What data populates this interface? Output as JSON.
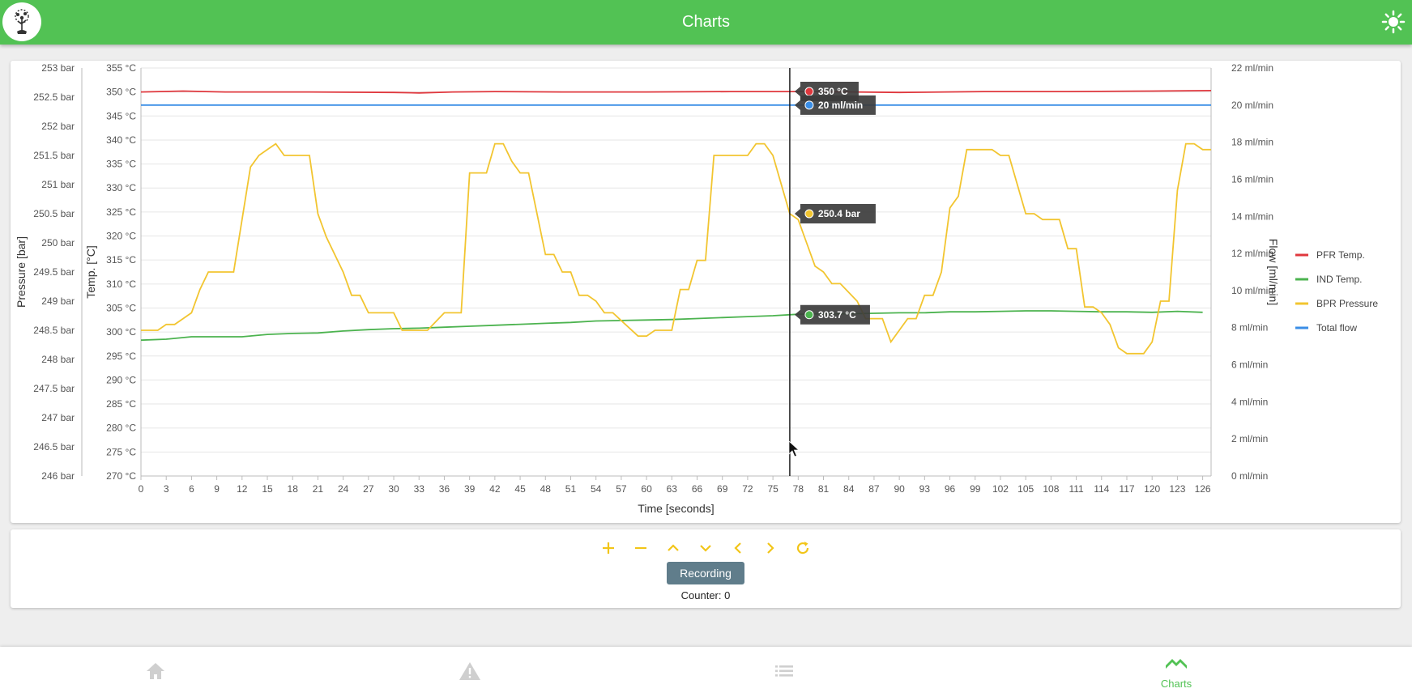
{
  "header": {
    "title": "Charts",
    "logo_icon": "tree-logo-icon",
    "theme_icon": "sun-icon"
  },
  "colors": {
    "primary": "#52c254",
    "accent": "#f5c518",
    "pfr": "#e0383e",
    "ind": "#4cb34f",
    "bpr": "#f2c530",
    "flow": "#3a8ee6"
  },
  "chart_data": {
    "type": "line",
    "xlabel": "Time [seconds]",
    "xlim": [
      0,
      127
    ],
    "xticks": [
      0,
      3,
      6,
      9,
      12,
      15,
      18,
      21,
      24,
      27,
      30,
      33,
      36,
      39,
      42,
      45,
      48,
      51,
      54,
      57,
      60,
      63,
      66,
      69,
      72,
      75,
      78,
      81,
      84,
      87,
      90,
      93,
      96,
      99,
      102,
      105,
      108,
      111,
      114,
      117,
      120,
      123,
      126
    ],
    "axes": {
      "pressure": {
        "label": "Pressure [bar]",
        "min": 246,
        "max": 253,
        "step": 0.5,
        "unit": "bar"
      },
      "temp": {
        "label": "Temp. [°C]",
        "min": 270,
        "max": 355,
        "step": 5,
        "unit": "°C"
      },
      "flow": {
        "label": "Flow [ml/min]",
        "min": 0,
        "max": 22,
        "step": 2,
        "unit": "ml/min"
      }
    },
    "series": [
      {
        "name": "PFR Temp.",
        "axis": "temp",
        "color": "#e0383e",
        "x": [
          0,
          5,
          10,
          20,
          30,
          33,
          37,
          42,
          50,
          60,
          70,
          80,
          90,
          100,
          110,
          120,
          127
        ],
        "y": [
          350,
          350.2,
          350,
          350,
          349.9,
          349.8,
          350,
          350.1,
          350,
          350,
          350.1,
          350.1,
          349.9,
          350.1,
          350.1,
          350.2,
          350.3
        ]
      },
      {
        "name": "IND Temp.",
        "axis": "temp",
        "color": "#4cb34f",
        "x": [
          0,
          3,
          6,
          9,
          12,
          15,
          18,
          21,
          24,
          27,
          30,
          33,
          36,
          39,
          42,
          45,
          48,
          51,
          54,
          57,
          60,
          63,
          66,
          69,
          72,
          75,
          78,
          81,
          84,
          87,
          90,
          93,
          96,
          99,
          102,
          105,
          108,
          111,
          114,
          117,
          120,
          123,
          126
        ],
        "y": [
          298.3,
          298.5,
          299,
          299,
          299,
          299.5,
          299.7,
          299.8,
          300.2,
          300.5,
          300.7,
          300.8,
          301,
          301.2,
          301.4,
          301.6,
          301.8,
          302,
          302.3,
          302.4,
          302.5,
          302.6,
          302.8,
          303,
          303.2,
          303.4,
          303.7,
          303.8,
          303.8,
          303.9,
          304,
          304,
          304.2,
          304.2,
          304.3,
          304.4,
          304.4,
          304.3,
          304.2,
          304.2,
          304.1,
          304.3,
          304.1
        ]
      },
      {
        "name": "BPR Pressure",
        "axis": "pressure",
        "color": "#f2c530",
        "x": [
          0,
          2,
          3,
          4,
          5,
          6,
          7,
          8,
          11,
          12,
          13,
          14,
          15,
          16,
          17,
          20,
          21,
          22,
          23,
          24,
          25,
          26,
          27,
          30,
          31,
          33,
          34,
          36,
          37,
          38,
          39,
          41,
          42,
          43,
          44,
          45,
          46,
          48,
          49,
          50,
          51,
          52,
          53,
          54,
          55,
          56,
          59,
          60,
          61,
          62,
          63,
          64,
          65,
          66,
          67,
          68,
          71,
          72,
          73,
          74,
          75,
          76,
          77,
          78,
          79,
          80,
          81,
          82,
          83,
          85,
          86,
          88,
          89,
          90,
          91,
          92,
          93,
          94,
          95,
          96,
          97,
          98,
          99,
          100,
          101,
          102,
          103,
          104,
          105,
          106,
          107,
          108,
          109,
          110,
          111,
          112,
          113,
          114,
          115,
          116,
          117,
          118,
          119,
          120,
          121,
          122,
          123,
          124,
          125,
          126,
          127
        ],
        "y": [
          248.5,
          248.5,
          248.6,
          248.6,
          248.7,
          248.8,
          249.2,
          249.5,
          249.5,
          250.4,
          251.3,
          251.5,
          251.6,
          251.7,
          251.5,
          251.5,
          250.5,
          250.1,
          249.8,
          249.5,
          249.1,
          249.1,
          248.8,
          248.8,
          248.5,
          248.5,
          248.5,
          248.8,
          248.8,
          248.8,
          251.2,
          251.2,
          251.7,
          251.7,
          251.4,
          251.2,
          251.2,
          249.8,
          249.8,
          249.5,
          249.5,
          249.1,
          249.1,
          249.0,
          248.8,
          248.8,
          248.4,
          248.4,
          248.5,
          248.5,
          248.5,
          249.2,
          249.2,
          249.7,
          249.7,
          251.5,
          251.5,
          251.5,
          251.7,
          251.7,
          251.5,
          251.0,
          250.5,
          250.4,
          250.0,
          249.6,
          249.5,
          249.3,
          249.3,
          249.0,
          248.7,
          248.7,
          248.3,
          248.5,
          248.7,
          248.7,
          249.1,
          249.1,
          249.5,
          250.6,
          250.8,
          251.6,
          251.6,
          251.6,
          251.6,
          251.5,
          251.5,
          251.0,
          250.5,
          250.5,
          250.4,
          250.4,
          250.4,
          249.9,
          249.9,
          248.9,
          248.9,
          248.8,
          248.6,
          248.2,
          248.1,
          248.1,
          248.1,
          248.3,
          249.0,
          249.0,
          250.9,
          251.7,
          251.7,
          251.6,
          251.6
        ]
      },
      {
        "name": "Total flow",
        "axis": "flow",
        "color": "#3a8ee6",
        "x": [
          0,
          127
        ],
        "y": [
          20,
          20
        ]
      }
    ],
    "legend": {
      "position": "right"
    },
    "crosshair": {
      "x": 77,
      "tooltips": [
        {
          "series": "PFR Temp.",
          "text": "350 °C"
        },
        {
          "series": "Total flow",
          "text": "20 ml/min"
        },
        {
          "series": "BPR Pressure",
          "text": "250.4 bar"
        },
        {
          "series": "IND Temp.",
          "text": "303.7 °C"
        }
      ]
    }
  },
  "controls": {
    "buttons": [
      "zoom-in",
      "zoom-out",
      "pan-up",
      "pan-down",
      "pan-left",
      "pan-right",
      "reset"
    ],
    "recording_label": "Recording",
    "counter_label": "Counter:",
    "counter_value": "0"
  },
  "nav": {
    "items": [
      {
        "name": "home",
        "icon": "home-icon",
        "label": ""
      },
      {
        "name": "alerts",
        "icon": "warning-icon",
        "label": ""
      },
      {
        "name": "list",
        "icon": "list-icon",
        "label": ""
      },
      {
        "name": "charts",
        "icon": "chart-icon",
        "label": "Charts",
        "active": true
      }
    ]
  }
}
